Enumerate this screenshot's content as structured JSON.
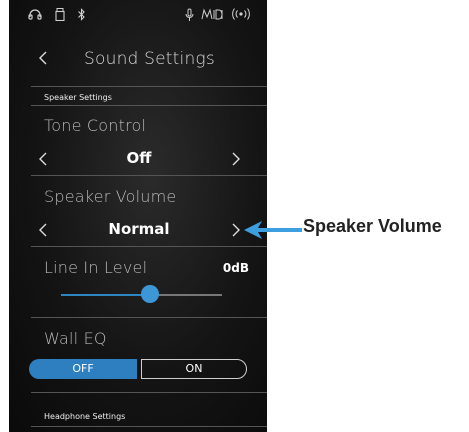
{
  "screen": {
    "title": "Sound Settings",
    "sections": {
      "speaker_settings": "Speaker Settings",
      "headphone_settings": "Headphone Settings"
    },
    "tone_control": {
      "label": "Tone Control",
      "value": "Off"
    },
    "speaker_volume": {
      "label": "Speaker Volume",
      "value": "Normal"
    },
    "line_in_level": {
      "label": "Line In Level",
      "value": "0dB",
      "slider_fraction": 0.55
    },
    "wall_eq": {
      "label": "Wall EQ",
      "off_label": "OFF",
      "on_label": "ON",
      "selected": "OFF"
    }
  },
  "annotation": {
    "label": "Speaker Volume"
  },
  "colors": {
    "accent": "#2e7fc0",
    "annotation": "#3d9fe0"
  },
  "status_icons": [
    "headphones-icon",
    "usb-icon",
    "bluetooth-icon",
    "microphone-icon",
    "midi-icon",
    "wireless-icon"
  ]
}
